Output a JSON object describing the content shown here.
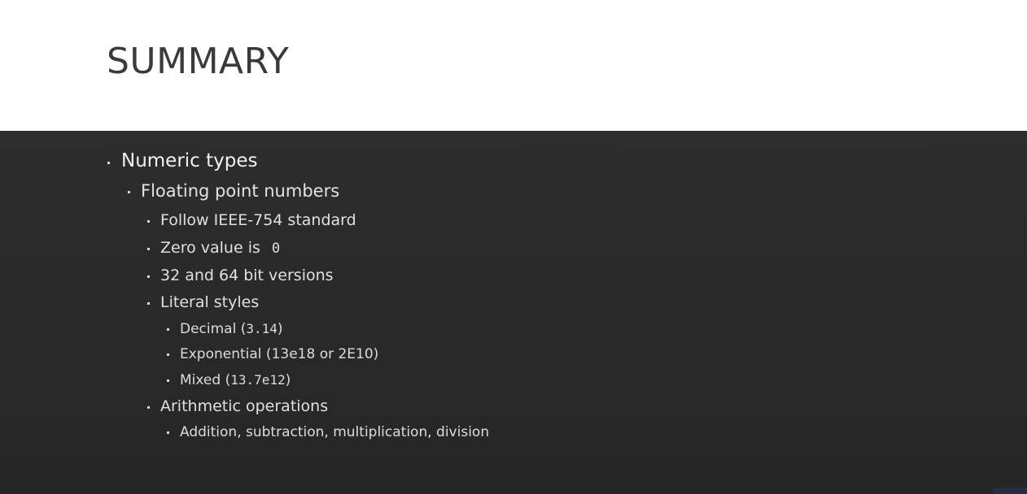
{
  "slide": {
    "title": "SUMMARY",
    "bullets": [
      {
        "text": "Numeric types"
      },
      {
        "text": "Floating point numbers"
      },
      {
        "text": "Follow IEEE-754 standard"
      },
      {
        "text": "Zero value is ",
        "code": "0"
      },
      {
        "text": "32 and 64 bit versions"
      },
      {
        "text": "Literal styles"
      },
      {
        "text": "Decimal (",
        "code": "3.14",
        "after": ")"
      },
      {
        "text": "Exponential (13e18 or 2E10)"
      },
      {
        "text": "Mixed (",
        "code": "13.7e12",
        "after": ")"
      },
      {
        "text": "Arithmetic operations"
      },
      {
        "text": "Addition, subtraction, multiplication, division"
      }
    ]
  },
  "colors": {
    "title_background": "#ffffff",
    "content_background": "#2b2b2b",
    "title_text": "#3a3a3a",
    "body_text": "#e6e6e6"
  }
}
